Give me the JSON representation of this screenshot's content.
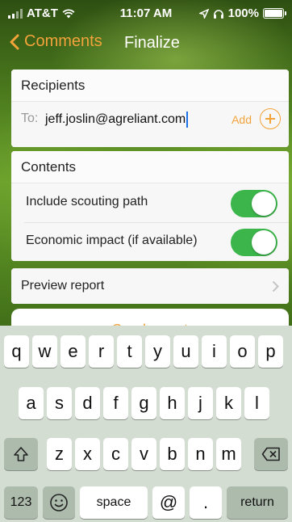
{
  "status_bar": {
    "carrier": "AT&T",
    "time": "11:07 AM",
    "battery": "100%"
  },
  "nav": {
    "back_label": "Comments",
    "title": "Finalize"
  },
  "recipients": {
    "header": "Recipients",
    "to_label": "To:",
    "to_value": "jeff.joslin@agreliant.com",
    "add_label": "Add"
  },
  "contents": {
    "header": "Contents",
    "options": [
      {
        "label": "Include scouting path",
        "enabled": true
      },
      {
        "label": "Economic impact (if available)",
        "enabled": true
      }
    ]
  },
  "preview": {
    "label": "Preview report"
  },
  "send": {
    "label": "Send report"
  },
  "keyboard": {
    "row1": [
      "q",
      "w",
      "e",
      "r",
      "t",
      "y",
      "u",
      "i",
      "o",
      "p"
    ],
    "row2": [
      "a",
      "s",
      "d",
      "f",
      "g",
      "h",
      "j",
      "k",
      "l"
    ],
    "row3": [
      "z",
      "x",
      "c",
      "v",
      "b",
      "n",
      "m"
    ],
    "numbers_key": "123",
    "space_key": "space",
    "at_key": "@",
    "dot_key": ".",
    "return_key": "return"
  },
  "colors": {
    "accent": "#f2a33a",
    "toggle_on": "#3cb54a",
    "keyboard_bg": "#d3ddd1"
  }
}
